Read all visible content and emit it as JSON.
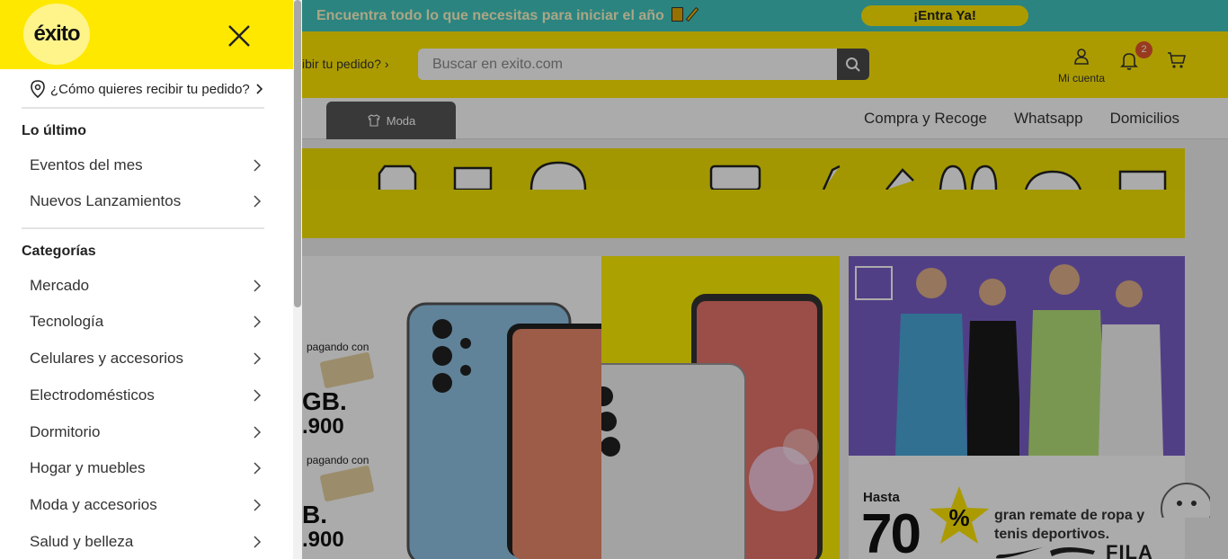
{
  "promo": {
    "text": "Encuentra todo lo que necesitas para iniciar el año",
    "cta_label": "¡Entra Ya!"
  },
  "header": {
    "delivery_text": "ibir tu pedido?",
    "search_placeholder": "Buscar en exito.com",
    "account_label": "Mi cuenta",
    "notifications_count": "2"
  },
  "nav": {
    "active_tab": "Moda",
    "links": [
      "Compra y Recoge",
      "Whatsapp",
      "Domicilios"
    ]
  },
  "hero": {
    "pay_label_1": "pagando con",
    "pay_label_2": "pagando con",
    "capacity_1": "GB.",
    "price_1": ".900",
    "capacity_2": "B.",
    "price_2": ".900"
  },
  "sale_banner": {
    "hasta": "Hasta",
    "percent": "70",
    "percent_sign": "%",
    "headline_line1": "gran remate de ropa y",
    "headline_line2": "tenis deportivos.",
    "brand": "FILA"
  },
  "side_menu": {
    "logo_text": "éxito",
    "delivery_prompt": "¿Cómo quieres recibir tu pedido?",
    "sections": [
      {
        "title": "Lo último",
        "items": [
          "Eventos del mes",
          "Nuevos Lanzamientos"
        ]
      },
      {
        "title": "Categorías",
        "items": [
          "Mercado",
          "Tecnología",
          "Celulares y accesorios",
          "Electrodomésticos",
          "Dormitorio",
          "Hogar y muebles",
          "Moda y accesorios",
          "Salud y belleza"
        ]
      }
    ]
  },
  "colors": {
    "brand_yellow": "#ffe800",
    "promo_teal": "#41c5bf",
    "badge_red": "#e4572e",
    "purple_banner": "#7a5fc8"
  }
}
